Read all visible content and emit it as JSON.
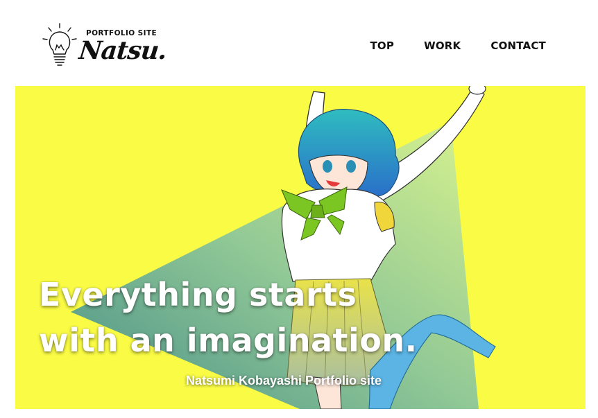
{
  "header": {
    "logo": {
      "small_text": "PORTFOLIO SITE",
      "big_text": "Natsu."
    },
    "nav": [
      {
        "label": "TOP"
      },
      {
        "label": "WORK"
      },
      {
        "label": "CONTACT"
      }
    ]
  },
  "hero": {
    "headline_line1": "Everything starts",
    "headline_line2": "with an imagination.",
    "subtitle": "Natsumi Kobayashi Portfolio site",
    "colors": {
      "background": "#f9fb45",
      "triangle_light": "#c9ef8c",
      "triangle_dark": "#3f8a8c",
      "hair": "#2fa6c9",
      "bow": "#7cc623",
      "socks": "#5bb4e4"
    }
  }
}
